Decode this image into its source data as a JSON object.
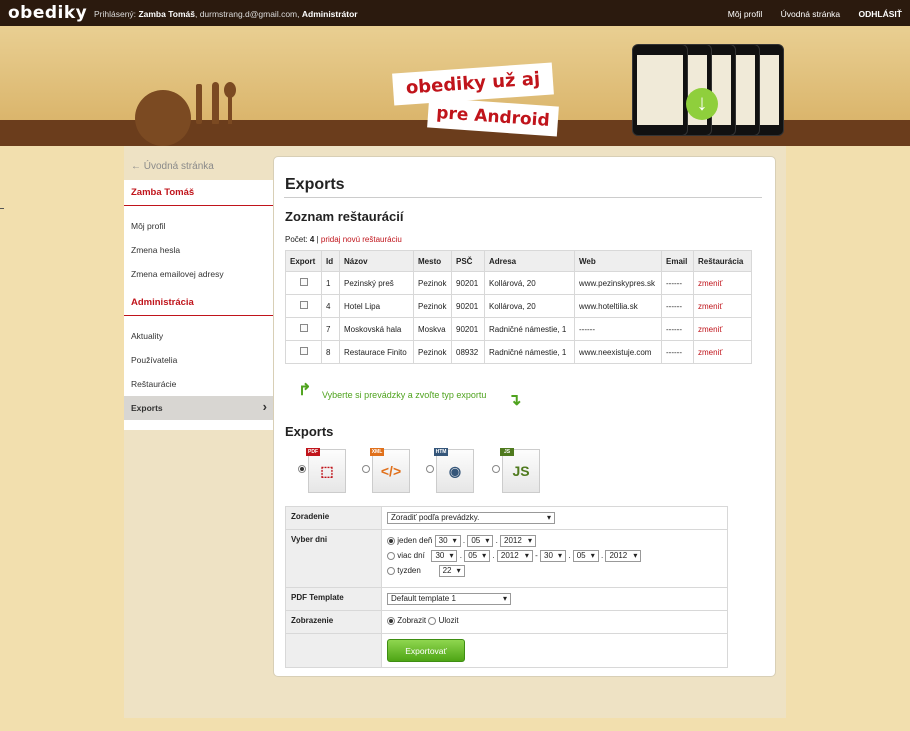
{
  "header": {
    "logo": "obediky",
    "user_prefix": "Prihlásený:",
    "user_name": "Zamba Tomáš",
    "user_email": ", durmstrang.d@gmail.com,",
    "user_role": "Administrátor",
    "nav": [
      "Môj profil",
      "Úvodná stránka",
      "ODHLÁSIŤ"
    ]
  },
  "banner": {
    "line1": "obediky už aj",
    "line2": "pre Android"
  },
  "sidebar": {
    "back": "← Úvodná stránka",
    "user_section": "Zamba Tomáš",
    "user_items": [
      "Môj profil",
      "Zmena hesla",
      "Zmena emailovej adresy"
    ],
    "admin_section": "Administrácia",
    "admin_items": [
      "Aktuality",
      "Používatelia",
      "Reštaurácie",
      "Exports"
    ]
  },
  "main": {
    "title": "Exports",
    "restaurants_heading": "Zoznam reštaurácií",
    "count_label": "Počet:",
    "count_value": "4",
    "add_link": "pridaj novú reštauráciu",
    "columns": [
      "Export",
      "Id",
      "Názov",
      "Mesto",
      "PSČ",
      "Adresa",
      "Web",
      "Email",
      "Reštaurácia"
    ],
    "rows": [
      {
        "id": "1",
        "name": "Pezinský preš",
        "city": "Pezinok",
        "zip": "90201",
        "address": "Kollárová, 20",
        "web": "www.pezinskypres.sk",
        "email": "------",
        "action": "zmeniť"
      },
      {
        "id": "4",
        "name": "Hotel Lipa",
        "city": "Pezinok",
        "zip": "90201",
        "address": "Kollárova, 20",
        "web": "www.hoteltilia.sk",
        "email": "------",
        "action": "zmeniť"
      },
      {
        "id": "7",
        "name": "Moskovská hala",
        "city": "Moskva",
        "zip": "90201",
        "address": "Radničné námestie, 1",
        "web": "------",
        "email": "------",
        "action": "zmeniť"
      },
      {
        "id": "8",
        "name": "Restaurace Finito",
        "city": "Pezinok",
        "zip": "08932",
        "address": "Radničné námestie, 1",
        "web": "www.neexistuje.com",
        "email": "------",
        "action": "zmeniť"
      }
    ],
    "hint": "Vyberte si prevádzky a zvoľte typ exportu",
    "exports_heading": "Exports",
    "formats": [
      "pdf",
      "xml",
      "html",
      "js"
    ],
    "form": {
      "sort_label": "Zoradenie",
      "sort_value": "Zoradiť podľa prevádzky.",
      "days_label": "Vyber dni",
      "one_day": "jeden deň",
      "more_days": "viac dní",
      "week": "tyzden",
      "day": "30",
      "month": "05",
      "year": "2012",
      "week_value": "22",
      "dot": ".",
      "dash": "-",
      "template_label": "PDF Template",
      "template_value": "Default template 1",
      "display_label": "Zobrazenie",
      "show": "Zobrazit",
      "save": "Ulozit",
      "submit": "Exportovať"
    }
  }
}
